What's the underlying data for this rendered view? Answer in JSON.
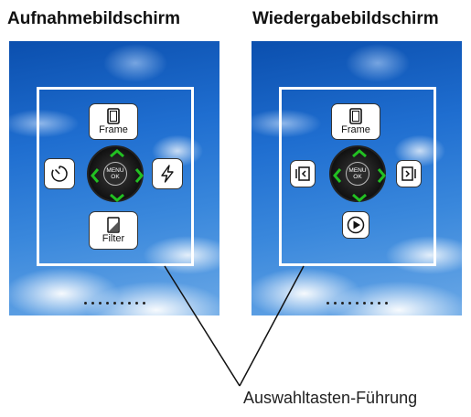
{
  "titles": {
    "left": "Aufnahmebildschirm",
    "right": "Wiedergabebildschirm"
  },
  "left_screen": {
    "top_button": {
      "icon": "frame-icon",
      "label": "Frame"
    },
    "left_button": {
      "icon": "self-timer-icon"
    },
    "right_button": {
      "icon": "flash-icon"
    },
    "bottom_button": {
      "icon": "filter-icon",
      "label": "Filter"
    },
    "dpad": {
      "line1": "MENU",
      "line2": "OK"
    },
    "page_dots": 9
  },
  "right_screen": {
    "top_button": {
      "icon": "frame-icon",
      "label": "Frame"
    },
    "left_button": {
      "icon": "previous-image-icon"
    },
    "right_button": {
      "icon": "next-image-icon"
    },
    "bottom_button": {
      "icon": "play-icon"
    },
    "dpad": {
      "line1": "MENU",
      "line2": "OK"
    },
    "page_dots": 9
  },
  "caption": "Auswahltasten-Führung",
  "colors": {
    "arrow": "#22c022",
    "frame_line": "#ffffff",
    "sky": "#1f6ed0"
  }
}
